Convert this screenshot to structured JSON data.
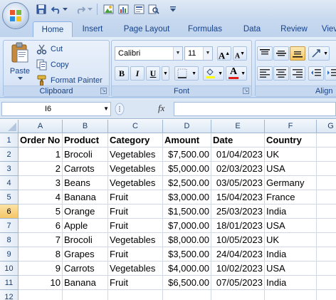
{
  "quick_access": {
    "icons": [
      "save-icon",
      "undo-icon",
      "redo-icon",
      "insert-picture-icon",
      "chart-icon",
      "form-icon",
      "print-preview-icon",
      "customize-icon"
    ]
  },
  "tabs": [
    {
      "label": "Home",
      "active": true
    },
    {
      "label": "Insert",
      "active": false
    },
    {
      "label": "Page Layout",
      "active": false
    },
    {
      "label": "Formulas",
      "active": false
    },
    {
      "label": "Data",
      "active": false
    },
    {
      "label": "Review",
      "active": false
    },
    {
      "label": "Viev",
      "active": false
    }
  ],
  "ribbon": {
    "clipboard": {
      "paste_label": "Paste",
      "cut_label": "Cut",
      "copy_label": "Copy",
      "format_painter_label": "Format Painter",
      "group_label": "Clipboard"
    },
    "font": {
      "font_name": "Calibri",
      "font_size": "11",
      "grow_label": "A",
      "shrink_label": "A",
      "bold_label": "B",
      "italic_label": "I",
      "underline_label": "U",
      "font_color_label": "A",
      "group_label": "Font"
    },
    "alignment": {
      "group_label": "Align"
    }
  },
  "formula_bar": {
    "name_box": "I6",
    "fx_label": "fx",
    "formula": ""
  },
  "sheet": {
    "columns": [
      "A",
      "B",
      "C",
      "D",
      "E",
      "F",
      "G"
    ],
    "rows": [
      "1",
      "2",
      "3",
      "4",
      "5",
      "6",
      "7",
      "8",
      "9",
      "10",
      "11",
      "12"
    ],
    "selected_row": "6",
    "header": [
      "Order No",
      "Product",
      "Category",
      "Amount",
      "Date",
      "Country"
    ],
    "data": [
      [
        "1",
        "Brocoli",
        "Vegetables",
        "$7,500.00",
        "01/04/2023",
        "UK"
      ],
      [
        "2",
        "Carrots",
        "Vegetables",
        "$5,000.00",
        "02/03/2023",
        "USA"
      ],
      [
        "3",
        "Beans",
        "Vegetables",
        "$2,500.00",
        "03/05/2023",
        "Germany"
      ],
      [
        "4",
        "Banana",
        "Fruit",
        "$3,000.00",
        "15/04/2023",
        "France"
      ],
      [
        "5",
        "Orange",
        "Fruit",
        "$1,500.00",
        "25/03/2023",
        "India"
      ],
      [
        "6",
        "Apple",
        "Fruit",
        "$7,000.00",
        "18/01/2023",
        "USA"
      ],
      [
        "7",
        "Brocoli",
        "Vegetables",
        "$8,000.00",
        "10/05/2023",
        "UK"
      ],
      [
        "8",
        "Grapes",
        "Fruit",
        "$3,500.00",
        "24/04/2023",
        "India"
      ],
      [
        "9",
        "Carrots",
        "Vegetables",
        "$4,000.00",
        "10/02/2023",
        "USA"
      ],
      [
        "10",
        "Banana",
        "Fruit",
        "$6,500.00",
        "07/05/2023",
        "India"
      ]
    ]
  }
}
